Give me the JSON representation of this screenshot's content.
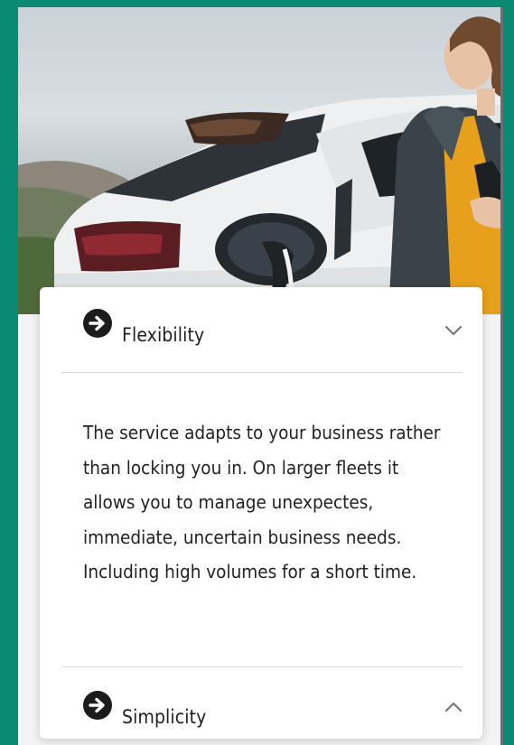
{
  "hero": {
    "image_alt": "Woman standing next to an electric car plugged into a charger"
  },
  "accordion": {
    "items": [
      {
        "icon": "arrow-right-circle-icon",
        "title": "Flexibility",
        "state": "expanded",
        "body": "The service adapts to your business rather than locking you in. On larger fleets it allows you to manage unexpectes, immediate, uncertain business needs. Including high volumes for a short time."
      },
      {
        "icon": "arrow-right-circle-icon",
        "title": "Simplicity",
        "state": "collapsed"
      }
    ]
  },
  "colors": {
    "page_background": "#0b8a73",
    "card_background": "#ffffff",
    "text": "#1f1f1f"
  }
}
